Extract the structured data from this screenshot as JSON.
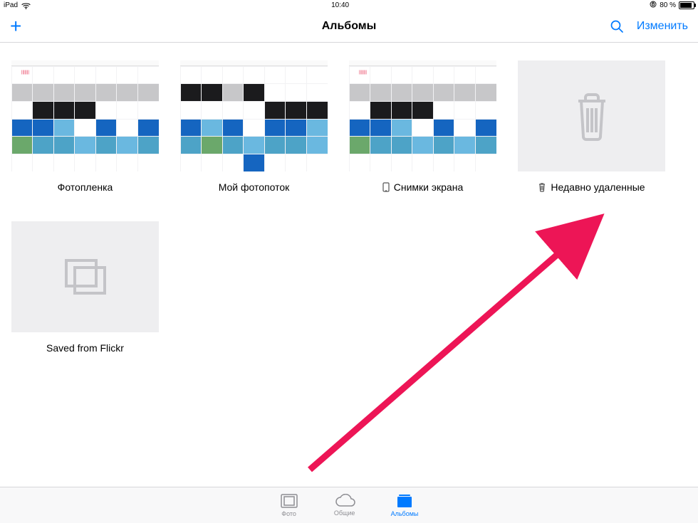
{
  "status": {
    "device": "iPad",
    "time": "10:40",
    "battery": "80 %"
  },
  "nav": {
    "title": "Альбомы",
    "edit": "Изменить"
  },
  "albums": [
    {
      "label": "Фотопленка",
      "kind": "collage"
    },
    {
      "label": "Мой фотопоток",
      "kind": "collage"
    },
    {
      "label": "Снимки экрана",
      "kind": "collage",
      "icon": "phone"
    },
    {
      "label": "Недавно удаленные",
      "kind": "trash",
      "icon": "trash"
    },
    {
      "label": "Saved from Flickr",
      "kind": "stack"
    }
  ],
  "tabs": [
    {
      "label": "Фото",
      "icon": "photo",
      "active": false
    },
    {
      "label": "Общие",
      "icon": "cloud",
      "active": false
    },
    {
      "label": "Альбомы",
      "icon": "albums",
      "active": true
    }
  ]
}
